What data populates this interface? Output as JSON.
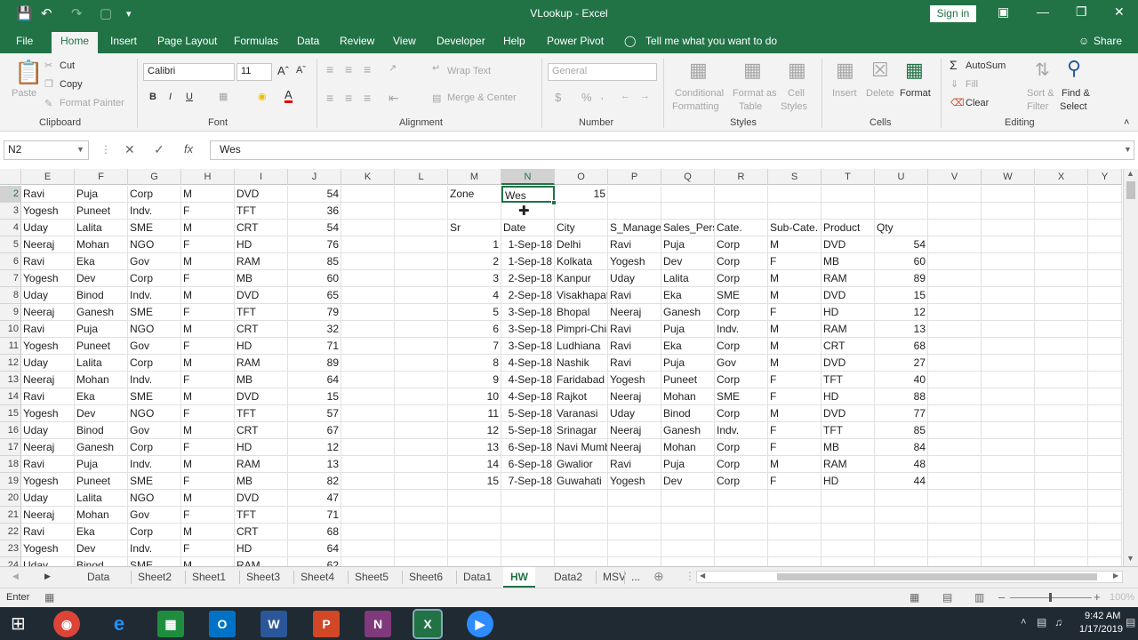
{
  "window": {
    "title": "VLookup - Excel",
    "signin": "Sign in"
  },
  "ribbon_tabs": [
    "File",
    "Home",
    "Insert",
    "Page Layout",
    "Formulas",
    "Data",
    "Review",
    "View",
    "Developer",
    "Help",
    "Power Pivot",
    "Tell me what you want to do",
    "Share"
  ],
  "ribbon": {
    "clipboard": {
      "paste": "Paste",
      "cut": "Cut",
      "copy": "Copy",
      "format_painter": "Format Painter",
      "label": "Clipboard"
    },
    "font": {
      "name": "Calibri",
      "size": "11",
      "label": "Font",
      "bold": "B",
      "italic": "I",
      "underline": "U"
    },
    "alignment": {
      "wrap": "Wrap Text",
      "merge": "Merge & Center",
      "label": "Alignment"
    },
    "number": {
      "format": "General",
      "label": "Number",
      "currency": "$",
      "percent": "%"
    },
    "styles": {
      "conditional": "Conditional",
      "conditional2": "Formatting",
      "format_as": "Format as",
      "format_as2": "Table",
      "cell": "Cell",
      "cell2": "Styles",
      "label": "Styles"
    },
    "cells": {
      "insert": "Insert",
      "delete": "Delete",
      "format": "Format",
      "label": "Cells"
    },
    "editing": {
      "autosum": "AutoSum",
      "fill": "Fill",
      "clear": "Clear",
      "sort": "Sort &",
      "sort2": "Filter",
      "find": "Find &",
      "find2": "Select",
      "label": "Editing"
    }
  },
  "formula_bar": {
    "name_box": "N2",
    "value": "Wes",
    "fx": "fx"
  },
  "columns": [
    "E",
    "F",
    "G",
    "H",
    "I",
    "J",
    "K",
    "L",
    "M",
    "N",
    "O",
    "P",
    "Q",
    "R",
    "S",
    "T",
    "U",
    "V",
    "W",
    "X",
    "Y"
  ],
  "rows": [
    "2",
    "3",
    "4",
    "5",
    "6",
    "7",
    "8",
    "9",
    "10",
    "11",
    "12",
    "13",
    "14",
    "15",
    "16",
    "17",
    "18",
    "19",
    "20",
    "21",
    "22",
    "23",
    "24"
  ],
  "left_table": [
    [
      "Ravi",
      "Puja",
      "Corp",
      "M",
      "DVD",
      "54"
    ],
    [
      "Yogesh",
      "Puneet",
      "Indv.",
      "F",
      "TFT",
      "36"
    ],
    [
      "Uday",
      "Lalita",
      "SME",
      "M",
      "CRT",
      "54"
    ],
    [
      "Neeraj",
      "Mohan",
      "NGO",
      "F",
      "HD",
      "76"
    ],
    [
      "Ravi",
      "Eka",
      "Gov",
      "M",
      "RAM",
      "85"
    ],
    [
      "Yogesh",
      "Dev",
      "Corp",
      "F",
      "MB",
      "60"
    ],
    [
      "Uday",
      "Binod",
      "Indv.",
      "M",
      "DVD",
      "65"
    ],
    [
      "Neeraj",
      "Ganesh",
      "SME",
      "F",
      "TFT",
      "79"
    ],
    [
      "Ravi",
      "Puja",
      "NGO",
      "M",
      "CRT",
      "32"
    ],
    [
      "Yogesh",
      "Puneet",
      "Gov",
      "F",
      "HD",
      "71"
    ],
    [
      "Uday",
      "Lalita",
      "Corp",
      "M",
      "RAM",
      "89"
    ],
    [
      "Neeraj",
      "Mohan",
      "Indv.",
      "F",
      "MB",
      "64"
    ],
    [
      "Ravi",
      "Eka",
      "SME",
      "M",
      "DVD",
      "15"
    ],
    [
      "Yogesh",
      "Dev",
      "NGO",
      "F",
      "TFT",
      "57"
    ],
    [
      "Uday",
      "Binod",
      "Gov",
      "M",
      "CRT",
      "67"
    ],
    [
      "Neeraj",
      "Ganesh",
      "Corp",
      "F",
      "HD",
      "12"
    ],
    [
      "Ravi",
      "Puja",
      "Indv.",
      "M",
      "RAM",
      "13"
    ],
    [
      "Yogesh",
      "Puneet",
      "SME",
      "F",
      "MB",
      "82"
    ],
    [
      "Uday",
      "Lalita",
      "NGO",
      "M",
      "DVD",
      "47"
    ],
    [
      "Neeraj",
      "Mohan",
      "Gov",
      "F",
      "TFT",
      "71"
    ],
    [
      "Ravi",
      "Eka",
      "Corp",
      "M",
      "CRT",
      "68"
    ],
    [
      "Yogesh",
      "Dev",
      "Indv.",
      "F",
      "HD",
      "64"
    ],
    [
      "Uday",
      "Binod",
      "SME",
      "M",
      "RAM",
      "62"
    ]
  ],
  "zone": {
    "label": "Zone",
    "value": "Wes",
    "count": "15"
  },
  "right_headers": [
    "Sr",
    "Date",
    "City",
    "S_Manager",
    "Sales_Person",
    "Cate.",
    "Sub-Cate.",
    "Product",
    "Qty"
  ],
  "right_table": [
    [
      "1",
      "1-Sep-18",
      "Delhi",
      "Ravi",
      "Puja",
      "Corp",
      "M",
      "DVD",
      "54"
    ],
    [
      "2",
      "1-Sep-18",
      "Kolkata",
      "Yogesh",
      "Dev",
      "Corp",
      "F",
      "MB",
      "60"
    ],
    [
      "3",
      "2-Sep-18",
      "Kanpur",
      "Uday",
      "Lalita",
      "Corp",
      "M",
      "RAM",
      "89"
    ],
    [
      "4",
      "2-Sep-18",
      "Visakhapatnam",
      "Ravi",
      "Eka",
      "SME",
      "M",
      "DVD",
      "15"
    ],
    [
      "5",
      "3-Sep-18",
      "Bhopal",
      "Neeraj",
      "Ganesh",
      "Corp",
      "F",
      "HD",
      "12"
    ],
    [
      "6",
      "3-Sep-18",
      "Pimpri-Chinchwad",
      "Ravi",
      "Puja",
      "Indv.",
      "M",
      "RAM",
      "13"
    ],
    [
      "7",
      "3-Sep-18",
      "Ludhiana",
      "Ravi",
      "Eka",
      "Corp",
      "M",
      "CRT",
      "68"
    ],
    [
      "8",
      "4-Sep-18",
      "Nashik",
      "Ravi",
      "Puja",
      "Gov",
      "M",
      "DVD",
      "27"
    ],
    [
      "9",
      "4-Sep-18",
      "Faridabad",
      "Yogesh",
      "Puneet",
      "Corp",
      "F",
      "TFT",
      "40"
    ],
    [
      "10",
      "4-Sep-18",
      "Rajkot",
      "Neeraj",
      "Mohan",
      "SME",
      "F",
      "HD",
      "88"
    ],
    [
      "11",
      "5-Sep-18",
      "Varanasi",
      "Uday",
      "Binod",
      "Corp",
      "M",
      "DVD",
      "77"
    ],
    [
      "12",
      "5-Sep-18",
      "Srinagar",
      "Neeraj",
      "Ganesh",
      "Indv.",
      "F",
      "TFT",
      "85"
    ],
    [
      "13",
      "6-Sep-18",
      "Navi Mumbai",
      "Neeraj",
      "Mohan",
      "Corp",
      "F",
      "MB",
      "84"
    ],
    [
      "14",
      "6-Sep-18",
      "Gwalior",
      "Ravi",
      "Puja",
      "Corp",
      "M",
      "RAM",
      "48"
    ],
    [
      "15",
      "7-Sep-18",
      "Guwahati",
      "Yogesh",
      "Dev",
      "Corp",
      "F",
      "HD",
      "44"
    ]
  ],
  "sheet_tabs": [
    "Data",
    "Sheet2",
    "Sheet1",
    "Sheet3",
    "Sheet4",
    "Sheet5",
    "Sheet6",
    "Data1",
    "HW",
    "Data2",
    "MSV",
    "..."
  ],
  "status": {
    "mode": "Enter",
    "zoom": "100%"
  },
  "taskbar": {
    "time": "9:42 AM",
    "date": "1/17/2019"
  },
  "colors": {
    "excel_green": "#217346",
    "selection": "#217346"
  }
}
